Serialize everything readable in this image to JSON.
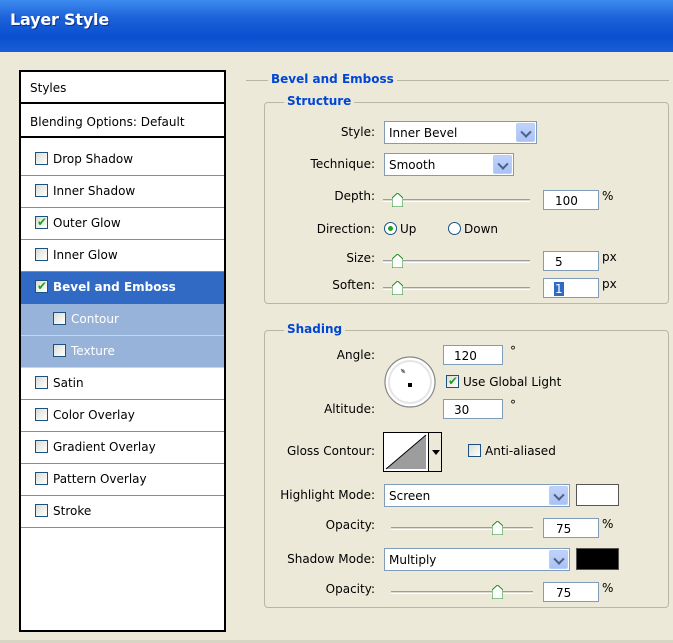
{
  "window": {
    "title": "Layer Style"
  },
  "styles_list": {
    "header": "Styles",
    "blending": "Blending Options: Default",
    "items": [
      {
        "label": "Drop Shadow",
        "checked": false
      },
      {
        "label": "Inner Shadow",
        "checked": false
      },
      {
        "label": "Outer Glow",
        "checked": true
      },
      {
        "label": "Inner Glow",
        "checked": false
      },
      {
        "label": "Bevel and Emboss",
        "checked": true,
        "selected": true
      },
      {
        "label": "Contour",
        "checked": false,
        "sub": true
      },
      {
        "label": "Texture",
        "checked": false,
        "sub": true
      },
      {
        "label": "Satin",
        "checked": false
      },
      {
        "label": "Color Overlay",
        "checked": false
      },
      {
        "label": "Gradient Overlay",
        "checked": false
      },
      {
        "label": "Pattern Overlay",
        "checked": false
      },
      {
        "label": "Stroke",
        "checked": false
      }
    ]
  },
  "bevel": {
    "section_title": "Bevel and Emboss",
    "structure": {
      "title": "Structure",
      "style_label": "Style:",
      "style_value": "Inner Bevel",
      "technique_label": "Technique:",
      "technique_value": "Smooth",
      "depth_label": "Depth:",
      "depth_value": "100",
      "depth_unit": "%",
      "direction_label": "Direction:",
      "direction_up": "Up",
      "direction_down": "Down",
      "size_label": "Size:",
      "size_value": "5",
      "size_unit": "px",
      "soften_label": "Soften:",
      "soften_value": "1",
      "soften_unit": "px"
    },
    "shading": {
      "title": "Shading",
      "angle_label": "Angle:",
      "angle_value": "120",
      "angle_unit": "°",
      "global_light_label": "Use Global Light",
      "global_light_checked": true,
      "altitude_label": "Altitude:",
      "altitude_value": "30",
      "altitude_unit": "°",
      "gloss_contour_label": "Gloss Contour:",
      "anti_aliased_label": "Anti-aliased",
      "anti_aliased_checked": false,
      "highlight_mode_label": "Highlight Mode:",
      "highlight_mode_value": "Screen",
      "highlight_color": "#ffffff",
      "highlight_opacity_label": "Opacity:",
      "highlight_opacity_value": "75",
      "highlight_opacity_unit": "%",
      "shadow_mode_label": "Shadow Mode:",
      "shadow_mode_value": "Multiply",
      "shadow_color": "#000000",
      "shadow_opacity_label": "Opacity:",
      "shadow_opacity_value": "75",
      "shadow_opacity_unit": "%"
    }
  },
  "colors": {
    "title_bar": "#0a4fd0",
    "section_title": "#0046d5",
    "selection": "#316ac5",
    "sub_item": "#98b3d9",
    "check_green": "#21a121"
  }
}
